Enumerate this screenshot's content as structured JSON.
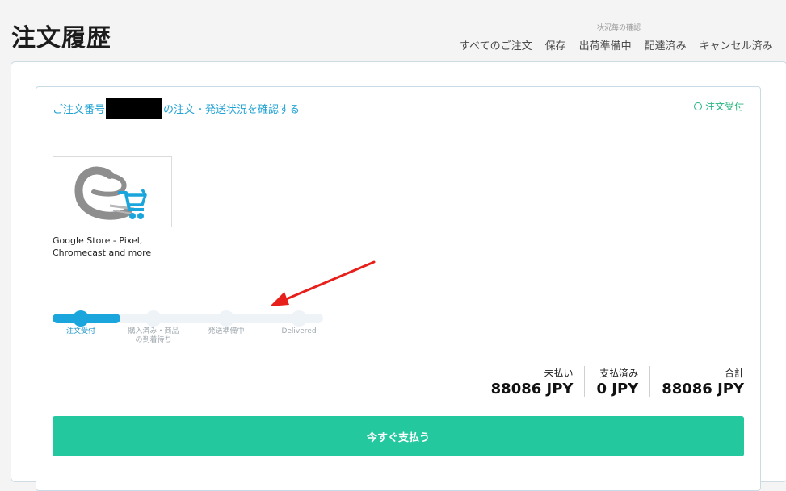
{
  "header": {
    "title": "注文履歴"
  },
  "filters": {
    "caption": "状況毎の確認",
    "items": [
      "すべてのご注文",
      "保存",
      "出荷準備中",
      "配達済み",
      "キャンセル済み"
    ]
  },
  "order": {
    "prefix": "ご注文番号",
    "suffix": "の注文・発送状況を確認する",
    "status_badge": "注文受付",
    "store": {
      "name": "Google Store - Pixel, Chromecast and more"
    }
  },
  "progress": {
    "completed_fraction": 0.25,
    "steps": [
      "注文受付",
      "購入済み・商品の到着待ち",
      "発送準備中",
      "Delivered"
    ]
  },
  "totals": {
    "unpaid_label": "未払い",
    "unpaid_value": "88086 JPY",
    "paid_label": "支払済み",
    "paid_value": "0 JPY",
    "total_label": "合計",
    "total_value": "88086 JPY"
  },
  "pay_button": {
    "label": "今すぐ支払う"
  },
  "colors": {
    "accent": "#1aa5dc",
    "success": "#27b57f",
    "pay_button": "#23c89f",
    "annotation_arrow": "#e8201c"
  }
}
